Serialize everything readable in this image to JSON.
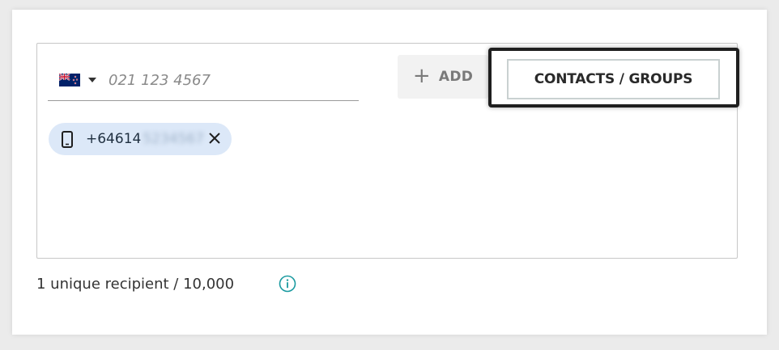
{
  "phone_input": {
    "placeholder": "021 123 4567",
    "value": ""
  },
  "country": {
    "flag_icon": "new-zealand-flag-icon",
    "selected": "New Zealand"
  },
  "buttons": {
    "add_icon": "plus-icon",
    "add_label": "ADD",
    "contacts_label": "CONTACTS / GROUPS"
  },
  "chip": {
    "icon": "mobile-phone-icon",
    "number_visible": "+64614",
    "number_redacted": "5234567",
    "remove_icon": "close-icon"
  },
  "footer": {
    "recipient_count": "1 unique recipient / 10,000",
    "info_icon": "info-icon"
  },
  "colors": {
    "chip_background": "#dce8f8",
    "info_accent": "#1a9aa0",
    "highlight_border": "#1f1f1f"
  }
}
